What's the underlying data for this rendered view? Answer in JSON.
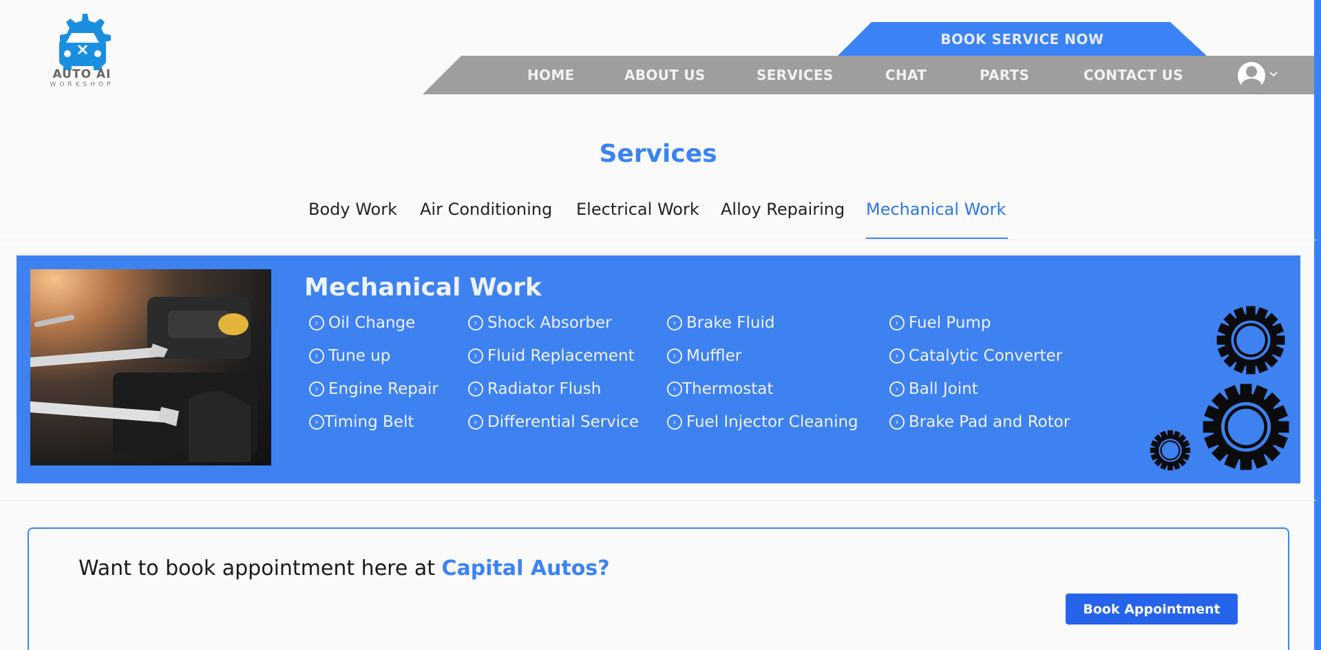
{
  "header": {
    "logo": {
      "line1": "AUTO AI",
      "line2": "WORKSHOP"
    },
    "book_service_label": "BOOK SERVICE NOW",
    "nav": [
      "HOME",
      "ABOUT US",
      "SERVICES",
      "CHAT",
      "PARTS",
      "CONTACT US"
    ]
  },
  "services": {
    "title": "Services",
    "tabs": [
      "Body Work",
      "Air Conditioning",
      "Electrical Work",
      "Alloy Repairing",
      "Mechanical Work"
    ],
    "active_tab": "Mechanical Work"
  },
  "panel": {
    "title": "Mechanical Work",
    "columns": [
      [
        "Oil Change",
        "Tune up",
        "Engine Repair",
        "Timing Belt"
      ],
      [
        "Shock Absorber",
        "Fluid Replacement",
        "Radiator Flush",
        "Differential Service"
      ],
      [
        "Brake Fluid",
        "Muffler",
        "Thermostat",
        "Fuel Injector Cleaning"
      ],
      [
        "Fuel Pump",
        "Catalytic Converter",
        "Ball Joint",
        "Brake Pad and Rotor"
      ]
    ]
  },
  "appointment": {
    "prompt": "Want to book appointment here at",
    "brand": "Capital Autos?",
    "button_label": "Book Appointment"
  },
  "colors": {
    "accent": "#3b82f6",
    "nav_bg": "#9e9e9e",
    "button": "#2563eb"
  },
  "icons": [
    "gear-car-logo-icon",
    "user-avatar-icon",
    "chevron-down-icon",
    "circle-chevron-right-icon",
    "gear-icon"
  ]
}
